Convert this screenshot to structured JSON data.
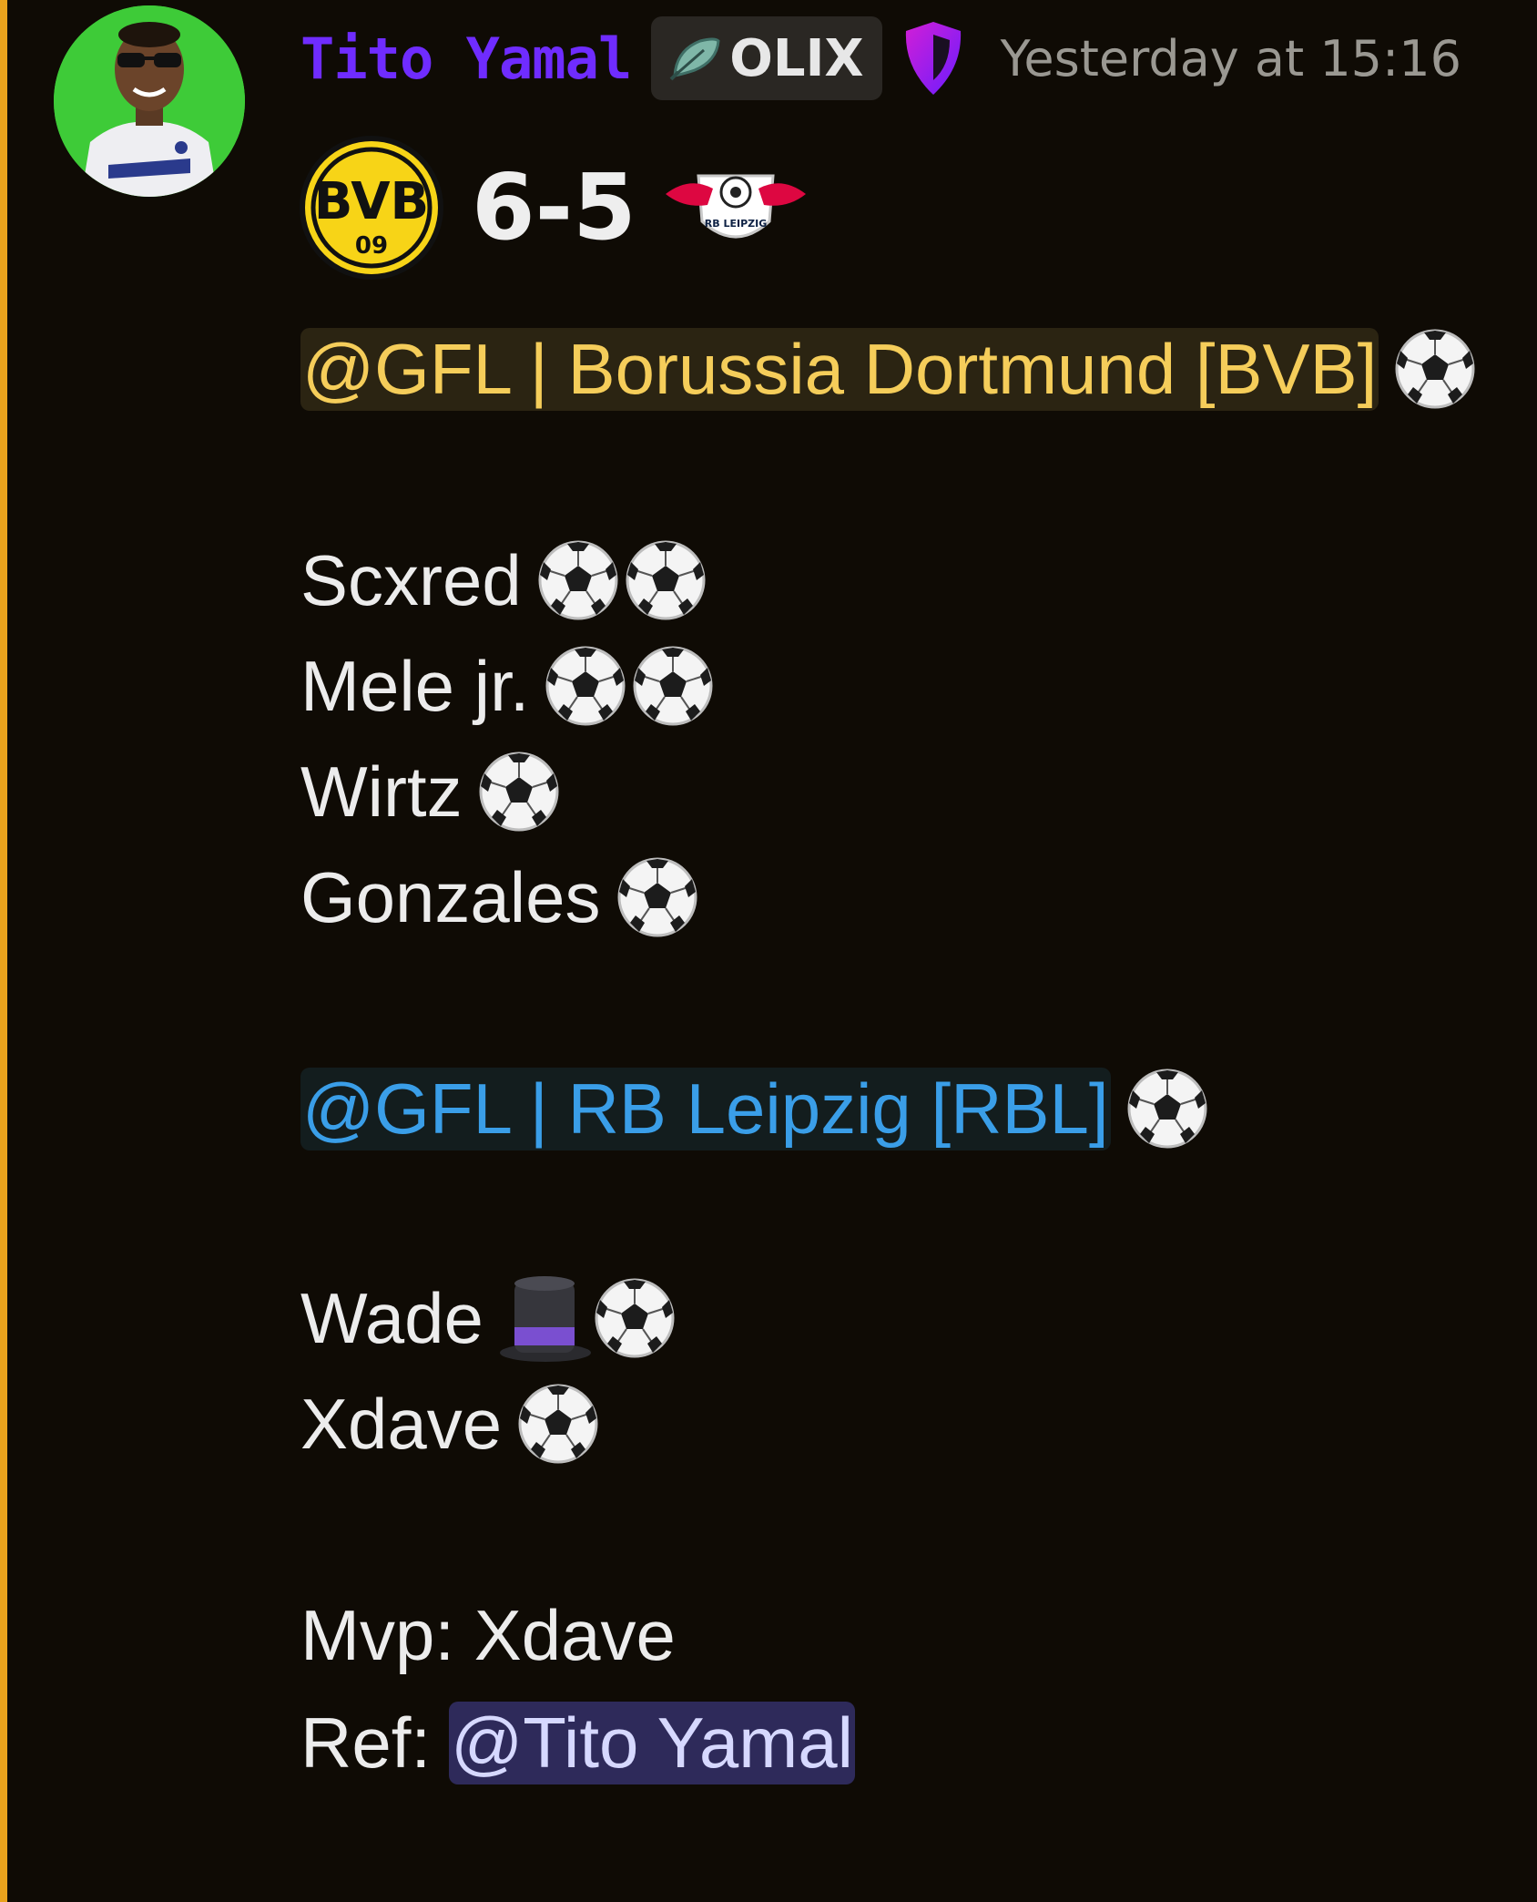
{
  "message": {
    "author": "Tito Yamal",
    "server_tag": "OLIX",
    "timestamp": "Yesterday at 15:16",
    "score": "6-5",
    "home_mention": "@GFL | Borussia Dortmund [BVB]",
    "home_scorers": [
      {
        "name": "Scxred",
        "goals": 2
      },
      {
        "name": "Mele jr.",
        "goals": 2
      },
      {
        "name": "Wirtz",
        "goals": 1
      },
      {
        "name": "Gonzales",
        "goals": 1
      }
    ],
    "away_mention": "@GFL | RB Leipzig [RBL]",
    "away_scorers": [
      {
        "name": "Wade",
        "goals": 1,
        "hat_icon": "top-hat-icon"
      },
      {
        "name": "Xdave",
        "goals": 1
      }
    ],
    "mvp": "Mvp: Xdave",
    "ref_label": "Ref:",
    "ref_mention": "@Tito Yamal"
  },
  "badges": {
    "home_logo_letters": "BVB",
    "home_logo_number": "09",
    "away_logo_text": "RB LEIPZIG"
  },
  "colors": {
    "accent_bar": "#e9a21d",
    "username": "#6f2cff",
    "bvb_mention": "#f5cd5a",
    "rbl_mention": "#3a9ee8",
    "user_mention_bg": "#2e2a5a"
  }
}
